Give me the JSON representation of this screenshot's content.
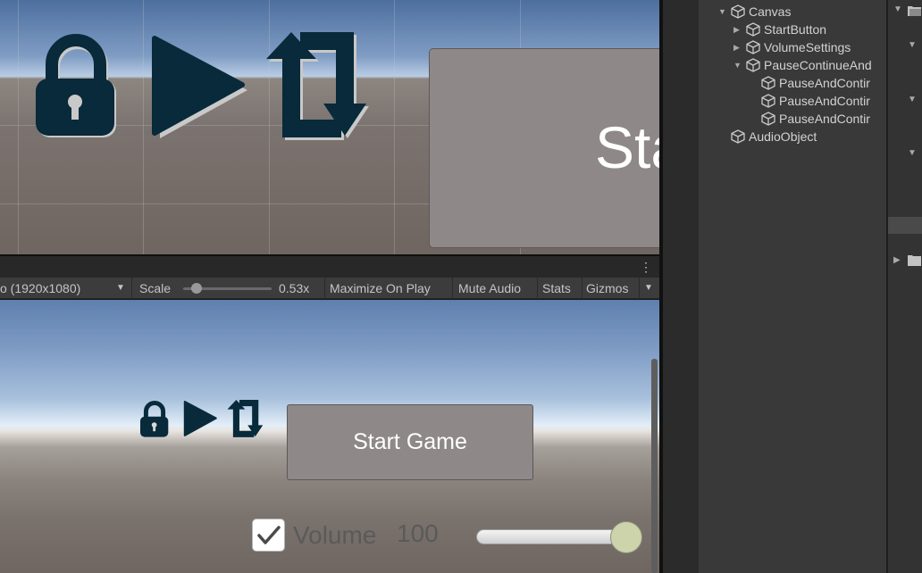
{
  "scene": {
    "start_button_text": "Sta"
  },
  "game_toolbar": {
    "resolution": "o (1920x1080)",
    "scale_label": "Scale",
    "scale_value": "0.53x",
    "maximize_on_play": "Maximize On Play",
    "mute_audio": "Mute Audio",
    "stats": "Stats",
    "gizmos": "Gizmos"
  },
  "game": {
    "start_button": "Start Game",
    "volume_label": "Volume",
    "volume_value": "100",
    "volume_checked": true,
    "volume_level": 1.0
  },
  "hierarchy": {
    "items": [
      {
        "label": "Canvas",
        "depth": 0,
        "expanded": true
      },
      {
        "label": "StartButton",
        "depth": 1,
        "expanded": false
      },
      {
        "label": "VolumeSettings",
        "depth": 1,
        "expanded": false
      },
      {
        "label": "PauseContinueAnd",
        "depth": 1,
        "expanded": true
      },
      {
        "label": "PauseAndContir",
        "depth": 2
      },
      {
        "label": "PauseAndContir",
        "depth": 2
      },
      {
        "label": "PauseAndContir",
        "depth": 2
      },
      {
        "label": "AudioObject",
        "depth": 0
      }
    ]
  },
  "colors": {
    "icon_dark": "#082a3a",
    "button_gray": "#8f8888",
    "editor_bg": "#393939"
  }
}
